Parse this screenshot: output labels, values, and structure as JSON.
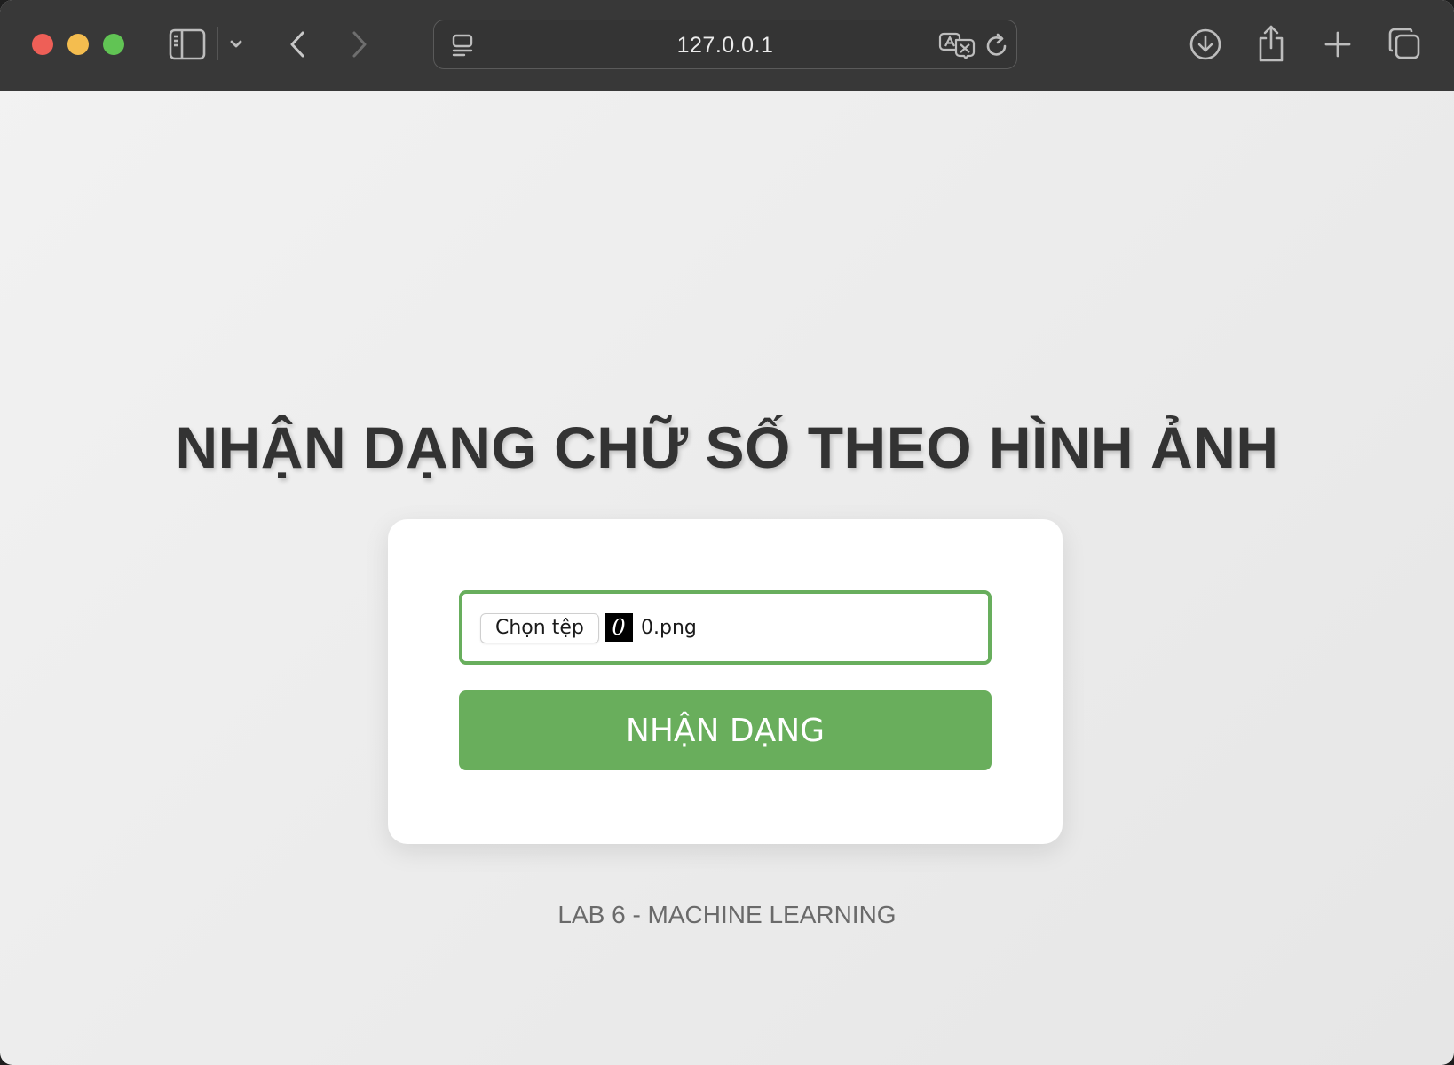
{
  "browser": {
    "address": "127.0.0.1",
    "icons": {
      "sidebar": "sidebar-icon",
      "tab_group_menu": "chevron-down-icon",
      "back": "chevron-left-icon",
      "forward": "chevron-right-icon",
      "page_menu": "page-menu-icon",
      "translate": "translate-icon",
      "reload": "reload-icon",
      "download": "download-icon",
      "share": "share-icon",
      "new_tab": "plus-icon",
      "tab_overview": "tabs-icon"
    }
  },
  "page": {
    "title": "NHẬN DẠNG CHỮ SỐ THEO HÌNH ẢNH",
    "form": {
      "choose_file_label": "Chọn tệp",
      "thumbnail_digit": "0",
      "selected_file": "0.png",
      "submit_label": "NHẬN DẠNG"
    },
    "footer": "LAB 6 - MACHINE LEARNING"
  },
  "colors": {
    "accent_green": "#69ae5c",
    "title_text": "#333333",
    "toolbar_bg": "#383838"
  }
}
